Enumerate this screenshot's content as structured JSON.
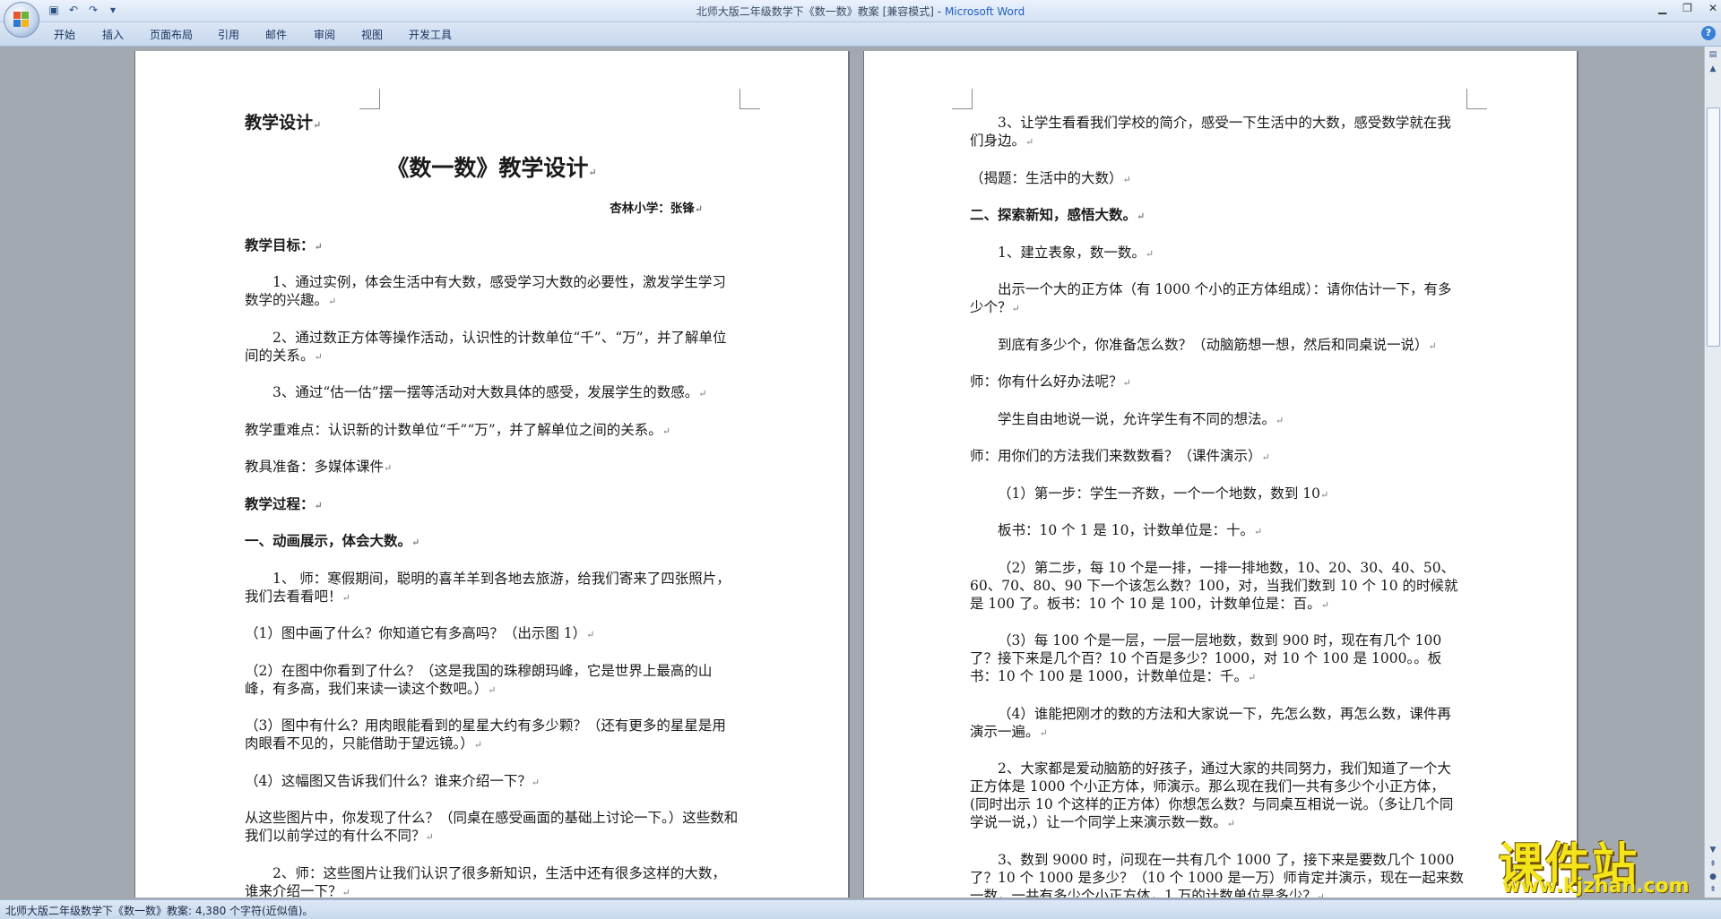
{
  "window": {
    "title": "北师大版二年级数学下《数一数》教案 [兼容模式]",
    "app_name": "Microsoft Word",
    "minimize_glyph": "▁",
    "restore_glyph": "❐",
    "close_glyph": "✕"
  },
  "quick_access": [
    "save-icon",
    "undo-icon",
    "redo-icon",
    "customize-icon"
  ],
  "ribbon": {
    "tabs": [
      "开始",
      "插入",
      "页面布局",
      "引用",
      "邮件",
      "审阅",
      "视图",
      "开发工具"
    ],
    "help_glyph": "?"
  },
  "page1": {
    "heading": "教学设计",
    "title": "《数一数》教学设计",
    "author": "杏林小学：张锋",
    "goals_label": "教学目标：",
    "goal1": "1、通过实例，体会生活中有大数，感受学习大数的必要性，激发学生学习数学的兴趣。",
    "goal2": "2、通过数正方体等操作活动，认识性的计数单位“千”、“万”，并了解单位间的关系。",
    "goal3": "3、通过“估一估”摆一摆等活动对大数具体的感受，发展学生的数感。",
    "key_points": "教学重难点：认识新的计数单位“千”“万”，并了解单位之间的关系。",
    "materials": "教具准备：多媒体课件",
    "process_label": "教学过程：",
    "section1": "一、动画展示，体会大数。",
    "p1": "1、 师：寒假期间，聪明的喜羊羊到各地去旅游，给我们寄来了四张照片，我们去看看吧！",
    "q1": "（1）图中画了什么？你知道它有多高吗？（出示图 1）",
    "q2": "（2）在图中你看到了什么？（这是我国的珠穆朗玛峰，它是世界上最高的山峰，有多高，我们来读一读这个数吧。）",
    "q3": "（3）图中有什么？用肉眼能看到的星星大约有多少颗？（还有更多的星星是用肉眼看不见的，只能借助于望远镜。）",
    "q4": "（4）这幅图又告诉我们什么？谁来介绍一下？",
    "discover": "从这些图片中，你发现了什么？（同桌在感受画面的基础上讨论一下。）这些数和我们以前学过的有什么不同？",
    "p2": "2、师：这些图片让我们认识了很多新知识，生活中还有很多这样的大数，谁来介绍一下？"
  },
  "page2": {
    "p3": "3、让学生看看我们学校的简介，感受一下生活中的大数，感受数学就在我们身边。",
    "reveal": "（揭题：生活中的大数）",
    "section2": "二、探索新知，感悟大数。",
    "s1": "1、建立表象，数一数。",
    "cube": "出示一个大的正方体（有 1000 个小的正方体组成）：请你估计一下，有多少个？",
    "how": "到底有多少个，你准备怎么数？（动脑筋想一想，然后和同桌说一说）",
    "teacher_q": "师：你有什么好办法呢？",
    "free": "学生自由地说一说，允许学生有不同的想法。",
    "count_demo": "师：用你们的方法我们来数数看？（课件演示）",
    "step1": "（1）第一步：学生一齐数，一个一个地数，数到 10",
    "board1": "板书：10 个 1 是 10，计数单位是：十。",
    "step2": "（2）第二步，每 10 个是一排，一排一排地数，10、20、30、40、50、60、70、80、90 下一个该怎么数？100，对，当我们数到 10 个 10 的时候就是 100 了。板书：10 个 10 是 100，计数单位是：百。",
    "step3": "（3）每 100 个是一层，一层一层地数，数到 900 时，现在有几个 100 了？接下来是几个百？10 个百是多少？1000，对 10 个 100 是 1000。。板书：10 个 100 是 1000，计数单位是：千。",
    "step4": "（4）谁能把刚才的数的方法和大家说一下，先怎么数，再怎么数，课件再演示一遍。",
    "s2": "2、大家都是爱动脑筋的好孩子，通过大家的共同努力，我们知道了一个大正方体是 1000 个小正方体，师演示。那么现在我们一共有多少个小正方体，(同时出示 10 个这样的正方体）你想怎么数？与同桌互相说一说。（多让几个同学说一说，）让一个同学上来演示数一数。",
    "s3": "3、数到 9000 时，问现在一共有几个 1000 了，接下来是要数几个 1000 了？10 个 1000 是多少？（10 个 1000 是一万）师肯定并演示，现在一起来数一数，一共有多少个小正方体，1 万的计数单位是多少？"
  },
  "paragraph_mark": "↵",
  "status_bar": {
    "text": "北师大版二年级数学下《数一数》教案: 4,380 个字符(近似值)。"
  },
  "watermark": {
    "text": "课件站",
    "url": "www.kjzhan.com"
  },
  "colors": {
    "app_name": "#1e5fbf",
    "watermark": "#f4e51a"
  }
}
